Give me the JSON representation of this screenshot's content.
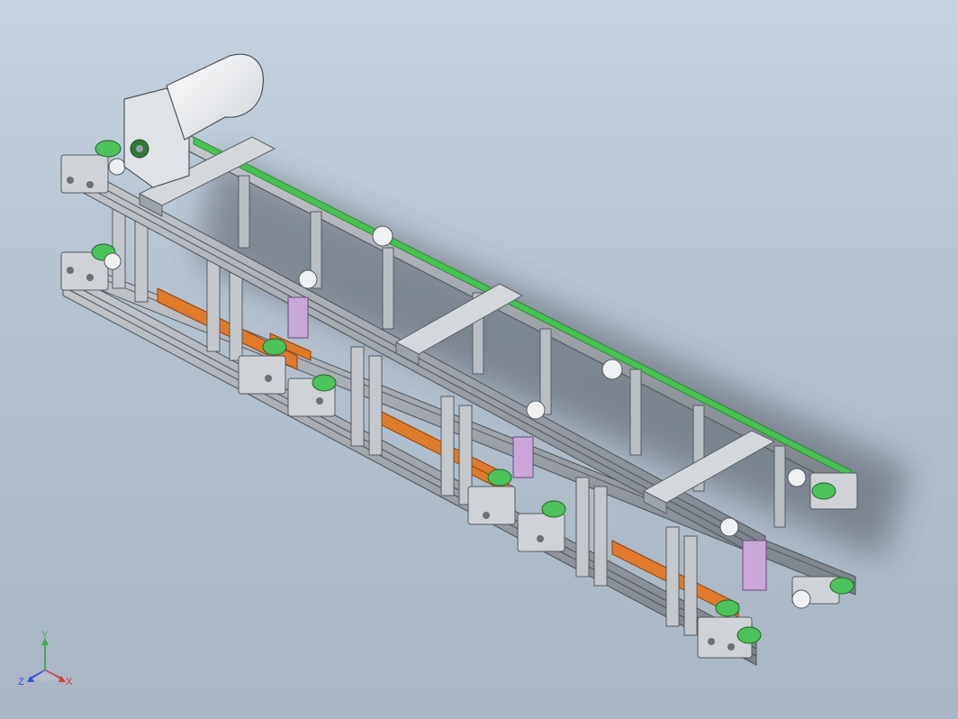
{
  "viewport": {
    "background_top": "#c7d3e0",
    "background_bottom": "#a9b6c4"
  },
  "model": {
    "frame_color": "#a7acb3",
    "frame_dark": "#6f757d",
    "belt_color": "#45c24f",
    "plate_color": "#e07a2a",
    "motor_color": "#eef0f2",
    "cylinder_color": "#c9a7d8"
  },
  "triad": {
    "x_label": "X",
    "y_label": "Y",
    "z_label": "Z",
    "x_color": "#d23a3a",
    "y_color": "#3ab04a",
    "z_color": "#2f55d6"
  }
}
